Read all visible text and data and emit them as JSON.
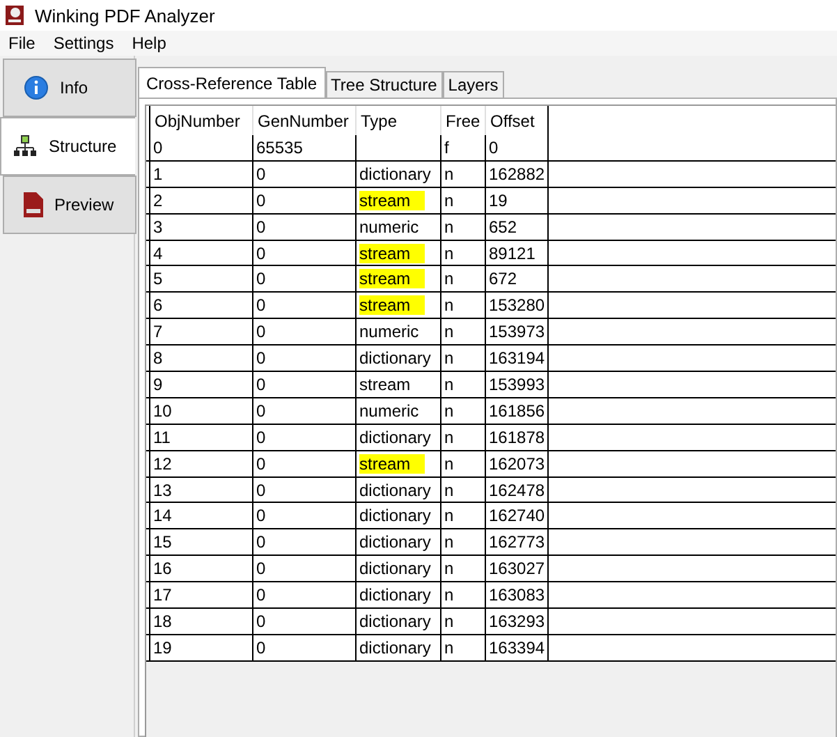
{
  "window": {
    "title": "Winking PDF Analyzer"
  },
  "menu": [
    "File",
    "Settings",
    "Help"
  ],
  "sidebar": {
    "items": [
      {
        "label": "Info",
        "selected": false
      },
      {
        "label": "Structure",
        "selected": true
      },
      {
        "label": "Preview",
        "selected": false
      }
    ]
  },
  "tabs": [
    {
      "label": "Cross-Reference Table",
      "selected": true
    },
    {
      "label": "Tree Structure",
      "selected": false
    },
    {
      "label": "Layers",
      "selected": false
    }
  ],
  "table": {
    "columns": [
      "ObjNumber",
      "GenNumber",
      "Type",
      "Free",
      "Offset"
    ],
    "rows": [
      {
        "cells": [
          "0",
          "65535",
          "",
          "f",
          "0"
        ],
        "highlighted": false
      },
      {
        "cells": [
          "1",
          "0",
          "dictionary",
          "n",
          "162882"
        ],
        "highlighted": false
      },
      {
        "cells": [
          "2",
          "0",
          "stream",
          "n",
          "19"
        ],
        "highlighted": true
      },
      {
        "cells": [
          "3",
          "0",
          "numeric",
          "n",
          "652"
        ],
        "highlighted": false
      },
      {
        "cells": [
          "4",
          "0",
          "stream",
          "n",
          "89121"
        ],
        "highlighted": true
      },
      {
        "cells": [
          "5",
          "0",
          "stream",
          "n",
          "672"
        ],
        "highlighted": true
      },
      {
        "cells": [
          "6",
          "0",
          "stream",
          "n",
          "153280"
        ],
        "highlighted": true
      },
      {
        "cells": [
          "7",
          "0",
          "numeric",
          "n",
          "153973"
        ],
        "highlighted": false
      },
      {
        "cells": [
          "8",
          "0",
          "dictionary",
          "n",
          "163194"
        ],
        "highlighted": false
      },
      {
        "cells": [
          "9",
          "0",
          "stream",
          "n",
          "153993"
        ],
        "highlighted": false
      },
      {
        "cells": [
          "10",
          "0",
          "numeric",
          "n",
          "161856"
        ],
        "highlighted": false
      },
      {
        "cells": [
          "11",
          "0",
          "dictionary",
          "n",
          "161878"
        ],
        "highlighted": false
      },
      {
        "cells": [
          "12",
          "0",
          "stream",
          "n",
          "162073"
        ],
        "highlighted": true
      },
      {
        "cells": [
          "13",
          "0",
          "dictionary",
          "n",
          "162478"
        ],
        "highlighted": false
      },
      {
        "cells": [
          "14",
          "0",
          "dictionary",
          "n",
          "162740"
        ],
        "highlighted": false
      },
      {
        "cells": [
          "15",
          "0",
          "dictionary",
          "n",
          "162773"
        ],
        "highlighted": false
      },
      {
        "cells": [
          "16",
          "0",
          "dictionary",
          "n",
          "163027"
        ],
        "highlighted": false
      },
      {
        "cells": [
          "17",
          "0",
          "dictionary",
          "n",
          "163083"
        ],
        "highlighted": false
      },
      {
        "cells": [
          "18",
          "0",
          "dictionary",
          "n",
          "163293"
        ],
        "highlighted": false
      },
      {
        "cells": [
          "19",
          "0",
          "dictionary",
          "n",
          "163394"
        ],
        "highlighted": false
      }
    ]
  }
}
